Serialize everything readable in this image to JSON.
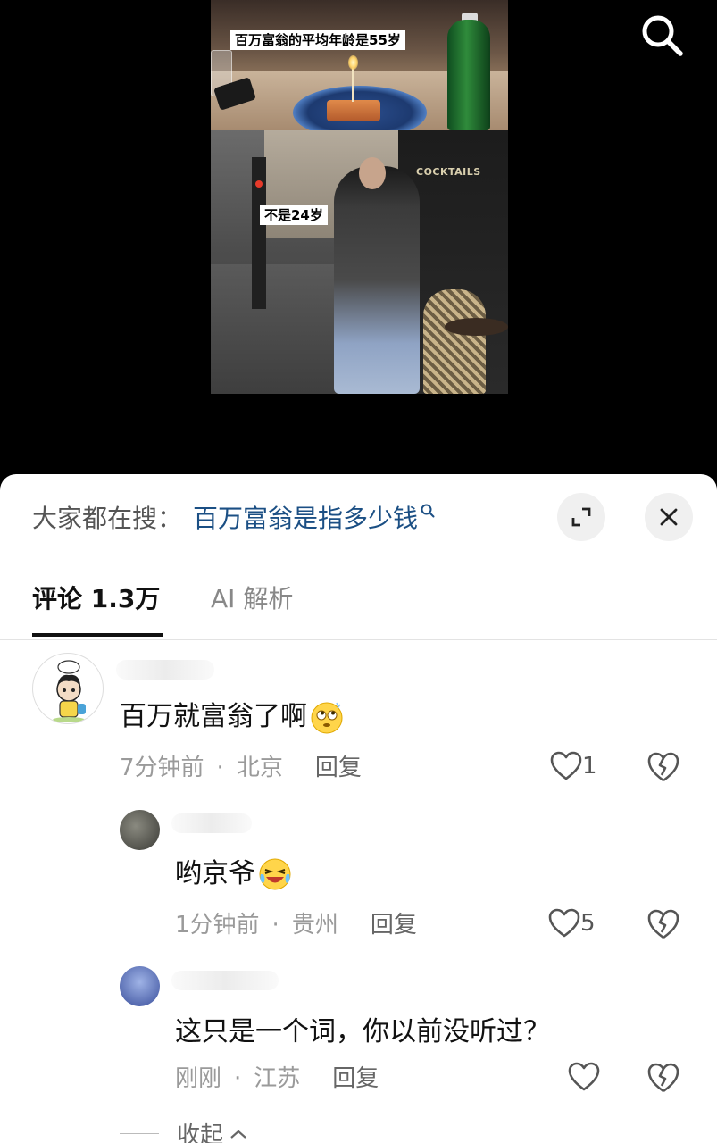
{
  "video": {
    "caption_top": "百万富翁的平均年龄是55岁",
    "caption_bottom": "不是24岁",
    "shop_sign": "COCKTAILS",
    "search_icon": "search-icon"
  },
  "sheet": {
    "trending_prefix": "大家都在搜：",
    "trending_term": "百万富翁是指多少钱",
    "expand_icon": "expand-icon",
    "close_icon": "close-icon"
  },
  "tabs": [
    {
      "label": "评论 1.3万",
      "active": true
    },
    {
      "label": "AI 解析",
      "active": false
    }
  ],
  "comments": [
    {
      "text": "百万就富翁了啊",
      "emoji": "rolling-eyes-emoji",
      "time": "7分钟前",
      "location": "北京",
      "reply_label": "回复",
      "likes": "1"
    },
    {
      "text": "哟京爷",
      "emoji": "laughing-crying-emoji",
      "time": "1分钟前",
      "location": "贵州",
      "reply_label": "回复",
      "likes": "5"
    },
    {
      "text": "这只是一个词，你以前没听过？",
      "time": "刚刚",
      "location": "江苏",
      "reply_label": "回复",
      "likes": ""
    }
  ],
  "collapse_label": "收起",
  "colors": {
    "trending_term": "#1b4f84",
    "sheet_bg": "#ffffff",
    "video_bg": "#000000"
  }
}
